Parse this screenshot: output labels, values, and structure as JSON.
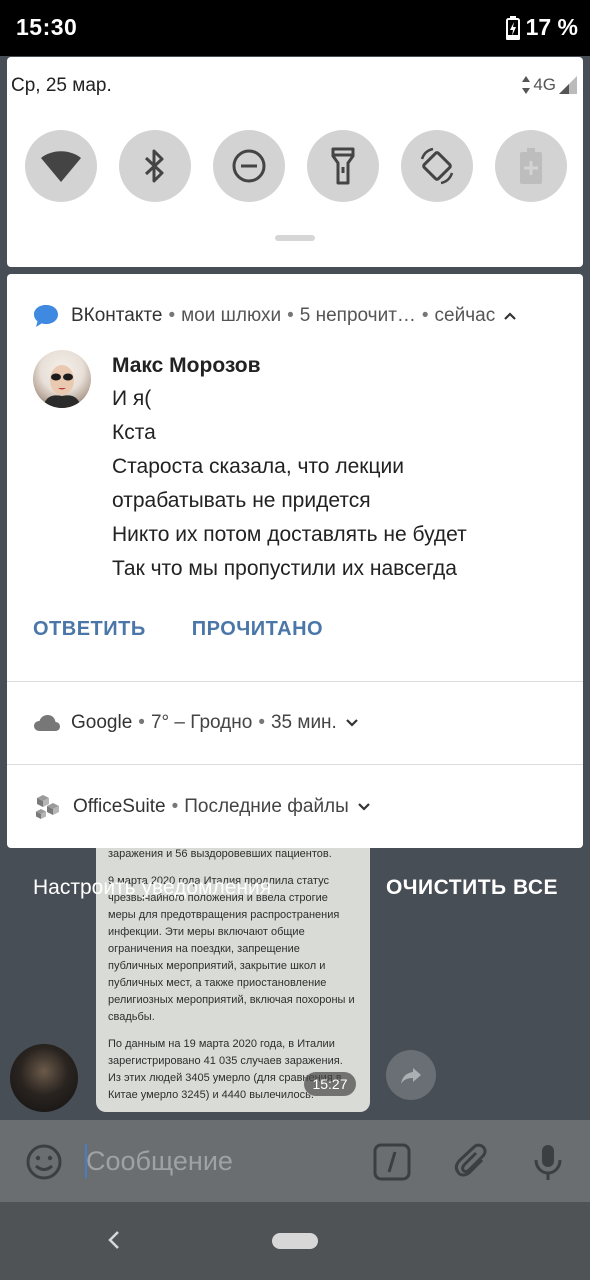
{
  "status_bar": {
    "time": "15:30",
    "battery": "17 %"
  },
  "quick_settings": {
    "date": "Ср, 25 мар.",
    "network": "4G"
  },
  "notification_vk": {
    "app": "ВКонтакте",
    "chat": "мои шлюхи",
    "unread": "5 непрочит…",
    "time": "сейчас",
    "sender": "Макс Морозов",
    "lines": [
      "И я(",
      "Кста",
      "Староста сказала, что лекции",
      "отрабатывать не придется",
      "Никто их потом доставлять не будет",
      "Так что мы пропустили их навсегда"
    ],
    "reply_label": "ОТВЕТИТЬ",
    "read_label": "ПРОЧИТАНО"
  },
  "notification_google": {
    "app": "Google",
    "info": "7° – Гродно",
    "time": "35 мин."
  },
  "notification_officesuite": {
    "app": "OfficeSuite",
    "info": "Последние файлы"
  },
  "shade_actions": {
    "manage": "Настроить уведомления",
    "clear_all": "ОЧИСТИТЬ ВСЕ"
  },
  "background_chat": {
    "paragraphs": [
      "заражения и 56 выздоровевших пациентов.",
      "9 марта 2020 года Италия продлила статус чрезвычайного положения и ввела строгие меры для предотвращения распространения инфекции. Эти меры включают общие ограничения на поездки, запрещение публичных мероприятий, закрытие школ и публичных мест, а также приостановление религиозных мероприятий, включая похороны и свадьбы.",
      "По данным на 19 марта 2020 года, в Италии зарегистрировано 41 035 случаев заражения. Из этих людей 3405 умерло (для сравнения в Китае умерло 3245) и 4440 вылечилось."
    ],
    "message_time": "15:27",
    "compose_placeholder": "Сообщение"
  }
}
